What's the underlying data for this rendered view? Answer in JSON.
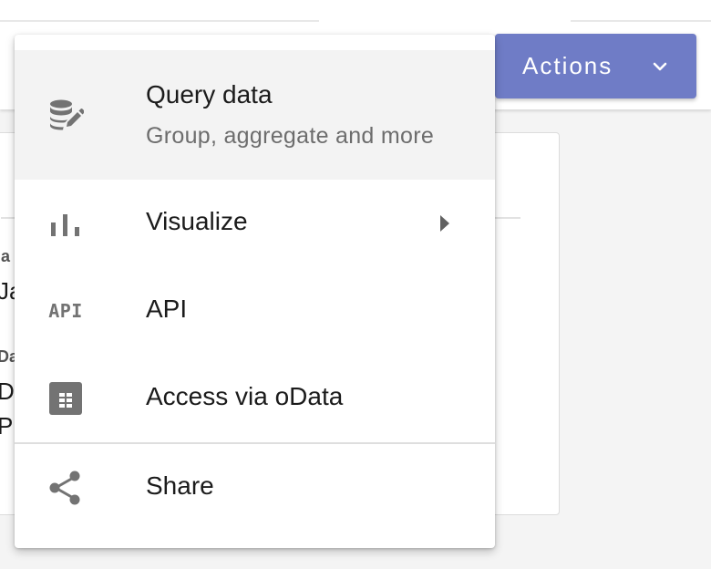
{
  "actions_button": {
    "label": "Actions",
    "icon": "chevron-down-icon"
  },
  "background_fragments": [
    "a",
    "Ja",
    "Da",
    "De",
    "Pr"
  ],
  "menu": {
    "items": [
      {
        "label": "Query data",
        "sublabel": "Group, aggregate and more",
        "icon": "database-edit-icon",
        "highlighted": true
      },
      {
        "label": "Visualize",
        "icon": "bar-chart-icon",
        "has_submenu": true
      },
      {
        "label": "API",
        "icon": "api-icon",
        "icon_text": "API"
      },
      {
        "label": "Access via oData",
        "icon": "table-icon"
      },
      {
        "label": "Share",
        "icon": "share-icon"
      }
    ]
  },
  "colors": {
    "accent": "#6f7cc6",
    "highlight": "#f3f3f3",
    "icon": "#737373",
    "secondary_text": "#6d6d6d"
  }
}
